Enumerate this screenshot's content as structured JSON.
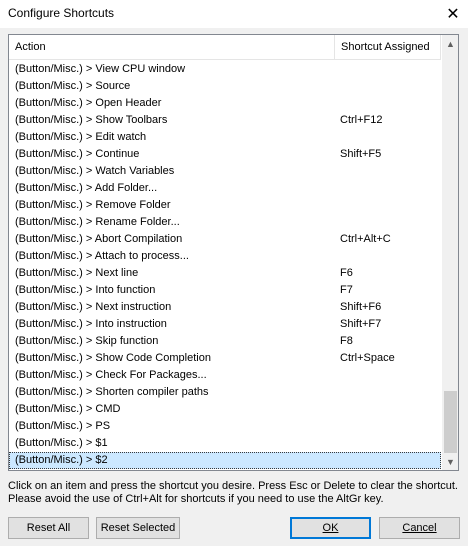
{
  "window": {
    "title": "Configure Shortcuts",
    "close_glyph": "✕"
  },
  "table": {
    "columns": {
      "action": "Action",
      "shortcut": "Shortcut Assigned"
    },
    "rows": [
      {
        "action": "(Button/Misc.) > View CPU window",
        "shortcut": ""
      },
      {
        "action": "(Button/Misc.) > Source",
        "shortcut": ""
      },
      {
        "action": "(Button/Misc.) > Open Header",
        "shortcut": ""
      },
      {
        "action": "(Button/Misc.) > Show Toolbars",
        "shortcut": "Ctrl+F12"
      },
      {
        "action": "(Button/Misc.) > Edit watch",
        "shortcut": ""
      },
      {
        "action": "(Button/Misc.) > Continue",
        "shortcut": "Shift+F5"
      },
      {
        "action": "(Button/Misc.) > Watch Variables",
        "shortcut": ""
      },
      {
        "action": "(Button/Misc.) > Add Folder...",
        "shortcut": ""
      },
      {
        "action": "(Button/Misc.) > Remove Folder",
        "shortcut": ""
      },
      {
        "action": "(Button/Misc.) > Rename Folder...",
        "shortcut": ""
      },
      {
        "action": "(Button/Misc.) > Abort Compilation",
        "shortcut": "Ctrl+Alt+C"
      },
      {
        "action": "(Button/Misc.) > Attach to process...",
        "shortcut": ""
      },
      {
        "action": "(Button/Misc.) > Next line",
        "shortcut": "F6"
      },
      {
        "action": "(Button/Misc.) > Into function",
        "shortcut": "F7"
      },
      {
        "action": "(Button/Misc.) > Next instruction",
        "shortcut": "Shift+F6"
      },
      {
        "action": "(Button/Misc.) > Into instruction",
        "shortcut": "Shift+F7"
      },
      {
        "action": "(Button/Misc.) > Skip function",
        "shortcut": "F8"
      },
      {
        "action": "(Button/Misc.) > Show Code Completion",
        "shortcut": "Ctrl+Space"
      },
      {
        "action": "(Button/Misc.) > Check For Packages...",
        "shortcut": ""
      },
      {
        "action": "(Button/Misc.) > Shorten compiler paths",
        "shortcut": ""
      },
      {
        "action": "(Button/Misc.) > CMD",
        "shortcut": ""
      },
      {
        "action": "(Button/Misc.) > PS",
        "shortcut": ""
      },
      {
        "action": "(Button/Misc.) > $1",
        "shortcut": ""
      },
      {
        "action": "(Button/Misc.) > $2",
        "shortcut": "",
        "selected": true
      }
    ],
    "scroll_up_glyph": "▲",
    "scroll_down_glyph": "▼"
  },
  "hint": {
    "line1": "Click on an item and press the shortcut you desire. Press Esc or Delete to clear the shortcut.",
    "line2": "Please avoid the use of Ctrl+Alt for shortcuts if you need to use the AltGr key."
  },
  "buttons": {
    "reset_all": "Reset All",
    "reset_selected": "Reset Selected",
    "ok": "OK",
    "cancel": "Cancel"
  },
  "colors": {
    "selection": "#cce8ff",
    "default_button_border": "#0078d7"
  }
}
